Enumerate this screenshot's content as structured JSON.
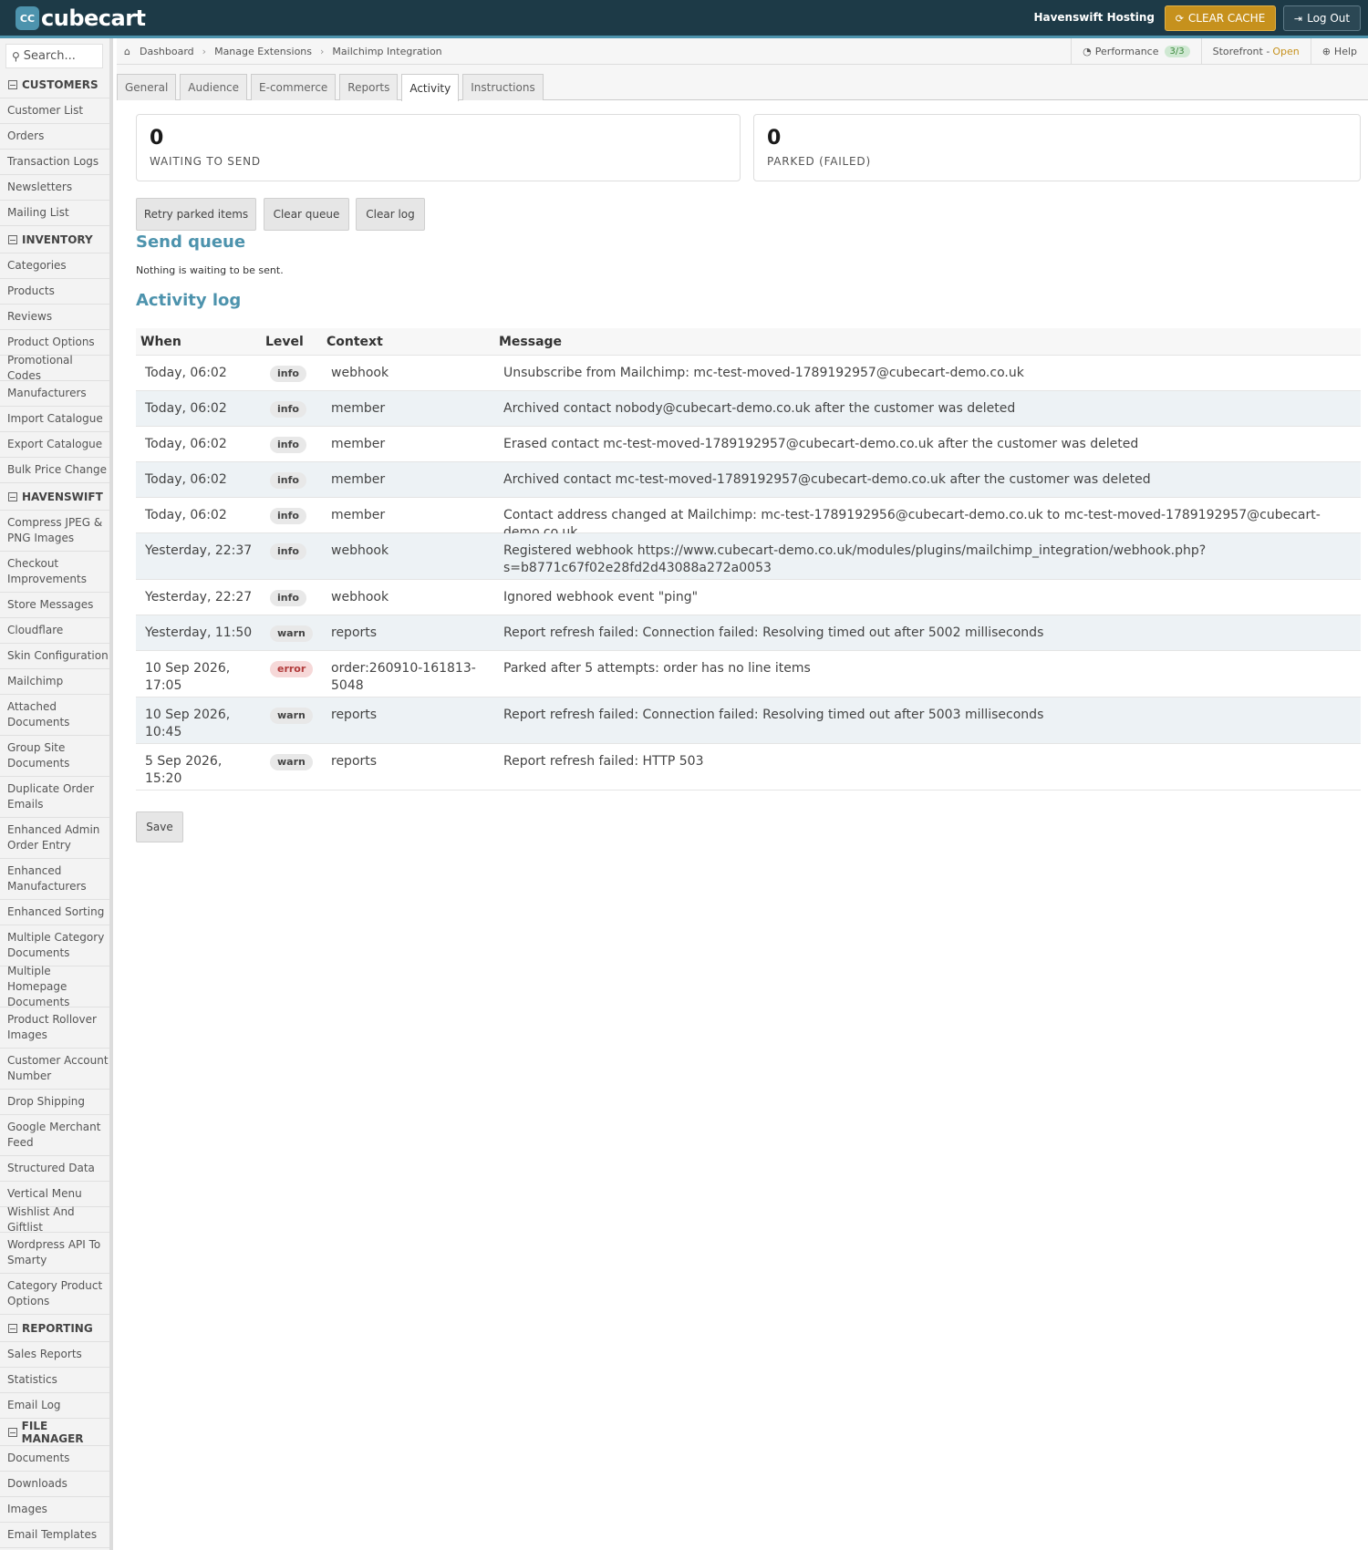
{
  "header": {
    "logo_text": "cubecart",
    "logo_mark": "CC",
    "store_name": "Havenswift Hosting",
    "clear_cache_label": "CLEAR CACHE",
    "logout_label": "Log Out",
    "colors": {
      "bar": "#1d3a47",
      "accent": "#4d93ad",
      "cache_button": "#c6911d"
    }
  },
  "sidebar": {
    "search_placeholder": "Search...",
    "sections": [
      {
        "title": "CUSTOMERS",
        "items": [
          "Customer List",
          "Orders",
          "Transaction Logs",
          "Newsletters",
          "Mailing List"
        ]
      },
      {
        "title": "INVENTORY",
        "items": [
          "Categories",
          "Products",
          "Reviews",
          "Product Options",
          "Promotional Codes",
          "Manufacturers",
          "Import Catalogue",
          "Export Catalogue",
          "Bulk Price Change"
        ]
      },
      {
        "title": "HAVENSWIFT",
        "items": [
          "Compress JPEG & PNG Images",
          "Checkout Improvements",
          "Store Messages",
          "Cloudflare",
          "Skin Configuration",
          "Mailchimp",
          "Attached Documents",
          "Group Site Documents",
          "Duplicate Order Emails",
          "Enhanced Admin Order Entry",
          "Enhanced Manufacturers",
          "Enhanced Sorting",
          "Multiple Category Documents",
          "Multiple Homepage Documents",
          "Product Rollover Images",
          "Customer Account Number",
          "Drop Shipping",
          "Google Merchant Feed",
          "Structured Data",
          "Vertical Menu",
          "Wishlist And Giftlist",
          "Wordpress API To Smarty",
          "Category Product Options"
        ]
      },
      {
        "title": "REPORTING",
        "items": [
          "Sales Reports",
          "Statistics",
          "Email Log"
        ]
      },
      {
        "title": "FILE MANAGER",
        "items": [
          "Documents",
          "Downloads",
          "Images",
          "Email Templates"
        ]
      }
    ]
  },
  "breadcrumb": {
    "items": [
      "Dashboard",
      "Manage Extensions",
      "Mailchimp Integration"
    ],
    "performance_label": "Performance",
    "performance_badge": "3/3",
    "storefront_label": "Storefront - ",
    "storefront_status": "Open",
    "help_label": "Help"
  },
  "tabs": [
    "General",
    "Audience",
    "E-commerce",
    "Reports",
    "Activity",
    "Instructions"
  ],
  "active_tab": "Activity",
  "stats": {
    "waiting": {
      "value": "0",
      "label": "WAITING TO SEND"
    },
    "parked": {
      "value": "0",
      "label": "PARKED (FAILED)"
    }
  },
  "actions": {
    "retry": "Retry parked items",
    "clear_queue": "Clear queue",
    "clear_log": "Clear log"
  },
  "send_queue": {
    "title": "Send queue",
    "empty_text": "Nothing is waiting to be sent."
  },
  "activity_log": {
    "title": "Activity log",
    "columns": [
      "When",
      "Level",
      "Context",
      "Message"
    ],
    "rows": [
      {
        "when": "Today, 06:02",
        "level": "info",
        "context": "webhook",
        "message": "Unsubscribe from Mailchimp: mc-test-moved-1789192957@cubecart-demo.co.uk"
      },
      {
        "when": "Today, 06:02",
        "level": "info",
        "context": "member",
        "message": "Archived contact nobody@cubecart-demo.co.uk after the customer was deleted"
      },
      {
        "when": "Today, 06:02",
        "level": "info",
        "context": "member",
        "message": "Erased contact mc-test-moved-1789192957@cubecart-demo.co.uk after the customer was deleted"
      },
      {
        "when": "Today, 06:02",
        "level": "info",
        "context": "member",
        "message": "Archived contact mc-test-moved-1789192957@cubecart-demo.co.uk after the customer was deleted"
      },
      {
        "when": "Today, 06:02",
        "level": "info",
        "context": "member",
        "message": "Contact address changed at Mailchimp: mc-test-1789192956@cubecart-demo.co.uk to mc-test-moved-1789192957@cubecart-demo.co.uk"
      },
      {
        "when": "Yesterday, 22:37",
        "level": "info",
        "context": "webhook",
        "message": "Registered webhook https://www.cubecart-demo.co.uk/modules/plugins/mailchimp_integration/webhook.php?s=b8771c67f02e28fd2d43088a272a0053"
      },
      {
        "when": "Yesterday, 22:27",
        "level": "info",
        "context": "webhook",
        "message": "Ignored webhook event \"ping\""
      },
      {
        "when": "Yesterday, 11:50",
        "level": "warn",
        "context": "reports",
        "message": "Report refresh failed: Connection failed: Resolving timed out after 5002 milliseconds"
      },
      {
        "when": "10 Sep 2026, 17:05",
        "level": "error",
        "context": "order:260910-161813-5048",
        "message": "Parked after 5 attempts: order has no line items"
      },
      {
        "when": "10 Sep 2026, 10:45",
        "level": "warn",
        "context": "reports",
        "message": "Report refresh failed: Connection failed: Resolving timed out after 5003 milliseconds"
      },
      {
        "when": "5 Sep 2026, 15:20",
        "level": "warn",
        "context": "reports",
        "message": "Report refresh failed: HTTP 503"
      }
    ]
  },
  "save_label": "Save"
}
